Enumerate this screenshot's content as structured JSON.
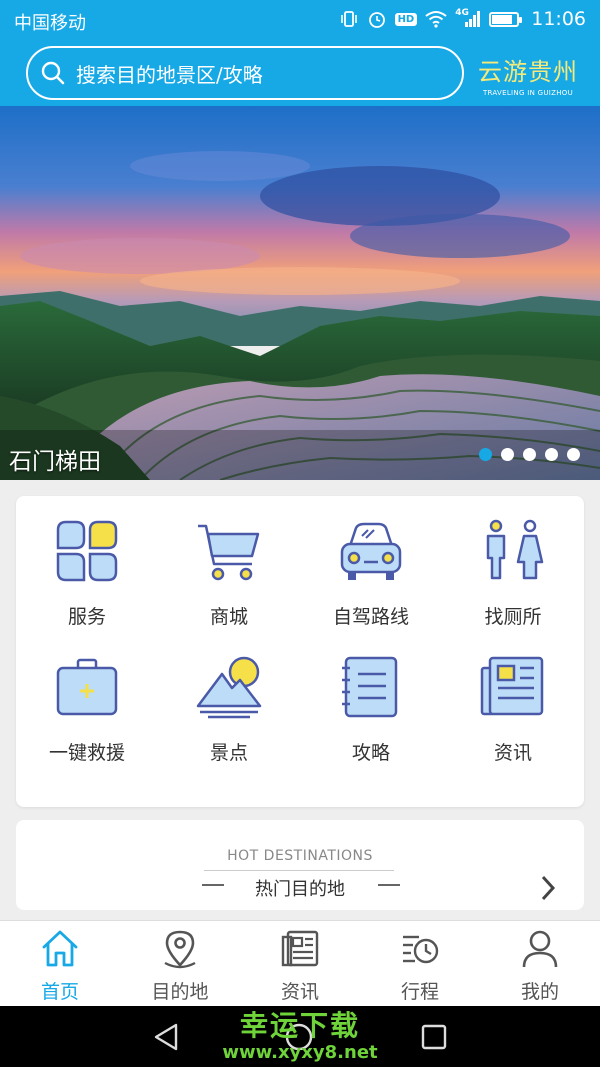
{
  "status_bar": {
    "carrier": "中国移动",
    "time": "11:06",
    "icons": [
      "vibrate-icon",
      "alarm-icon",
      "hd-icon",
      "wifi-icon",
      "4g-signal-icon",
      "battery-icon"
    ],
    "hd": "HD",
    "network": "4G",
    "battery_level": 0.85
  },
  "header": {
    "search_placeholder": "搜索目的地景区/攻略",
    "brand_cn": "云游贵州",
    "brand_en": "TRAVELING IN GUIZHOU"
  },
  "banner": {
    "caption": "石门梯田",
    "slide_count": 5,
    "active_slide": 1
  },
  "services": [
    {
      "label": "服务",
      "icon": "service-icon"
    },
    {
      "label": "商城",
      "icon": "shopping-cart-icon"
    },
    {
      "label": "自驾路线",
      "icon": "car-icon"
    },
    {
      "label": "找厕所",
      "icon": "toilet-icon"
    },
    {
      "label": "一键救援",
      "icon": "first-aid-kit-icon"
    },
    {
      "label": "景点",
      "icon": "mountain-icon"
    },
    {
      "label": "攻略",
      "icon": "notebook-icon"
    },
    {
      "label": "资讯",
      "icon": "news-icon"
    }
  ],
  "hot_destinations": {
    "title_en": "HOT DESTINATIONS",
    "title_cn": "热门目的地"
  },
  "bottom_nav": [
    {
      "label": "首页",
      "icon": "home-icon",
      "active": true
    },
    {
      "label": "目的地",
      "icon": "location-pin-icon",
      "active": false
    },
    {
      "label": "资讯",
      "icon": "newspaper-icon",
      "active": false
    },
    {
      "label": "行程",
      "icon": "schedule-icon",
      "active": false
    },
    {
      "label": "我的",
      "icon": "user-icon",
      "active": false
    }
  ],
  "watermark": {
    "line1": "幸运下载",
    "line2": "www.xyxy8.net"
  },
  "colors": {
    "primary": "#17a8e6",
    "accent_yellow": "#f5e04a",
    "icon_fill": "#bcdcf7",
    "icon_stroke": "#4a5aa8"
  }
}
